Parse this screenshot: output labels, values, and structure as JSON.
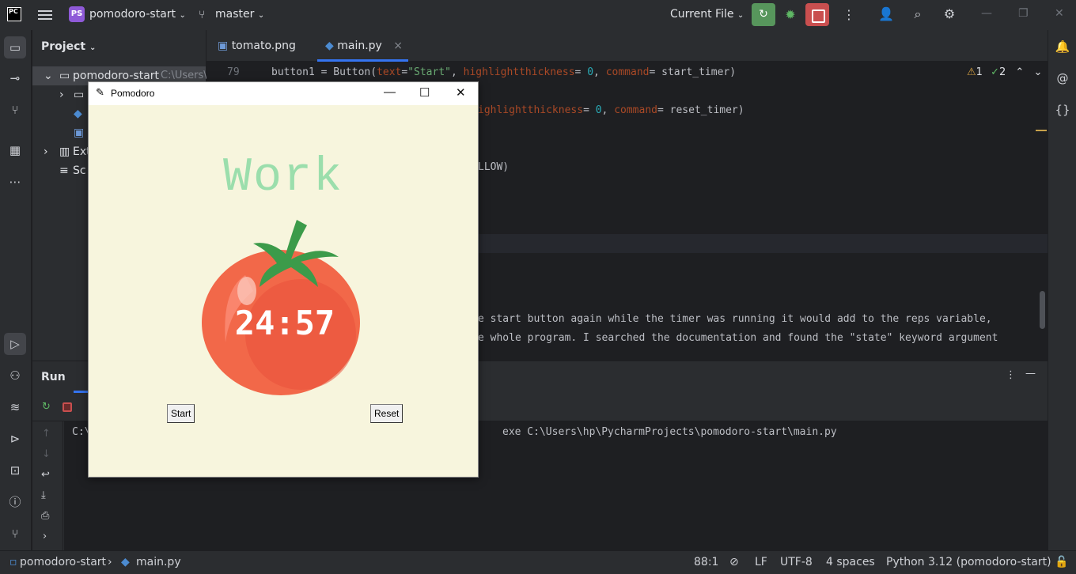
{
  "titlebar": {
    "logo_text": "PC",
    "project_badge": "PS",
    "project_name": "pomodoro-start",
    "branch": "master",
    "run_config": "Current File"
  },
  "project_pane": {
    "title": "Project",
    "root_name": "pomodoro-start",
    "root_path_hint": "C:\\Users\\",
    "ext_libs_partial": "Ext",
    "scratches_partial": "Sc"
  },
  "editor": {
    "tabs": [
      {
        "label": "tomato.png",
        "icon": "image-file-icon"
      },
      {
        "label": "main.py",
        "icon": "python-file-icon",
        "active": true
      }
    ],
    "line_number": "79",
    "inspections": {
      "warnings": "1",
      "typos": "2"
    },
    "lines": {
      "l1_a": "button1 = Button(",
      "l1_b": "text",
      "l1_c": "=",
      "l1_d": "\"Start\"",
      "l1_e": ", ",
      "l1_f": "highlightthickness",
      "l1_g": "= ",
      "l1_h": "0",
      "l1_i": ", ",
      "l1_j": "command",
      "l1_k": "= start_timer)",
      "l2_a": "ighlightthickness",
      "l2_b": "= ",
      "l2_c": "0",
      "l2_d": ", ",
      "l2_e": "command",
      "l2_f": "= reset_timer)",
      "l3": "LLOW)",
      "l4": "e start button again while the timer was running it would add to the reps variable,",
      "l5": "e whole program. I searched the documentation and found the \"state\" keyword argument"
    }
  },
  "run_panel": {
    "title": "Run",
    "console_prefix": "C:\\",
    "console_line": "exe C:\\Users\\hp\\PycharmProjects\\pomodoro-start\\main.py"
  },
  "statusbar": {
    "breadcrumb_project": "pomodoro-start",
    "breadcrumb_file": "main.py",
    "position": "88:1",
    "line_sep": "LF",
    "encoding": "UTF-8",
    "indent": "4 spaces",
    "interpreter": "Python 3.12 (pomodoro-start)"
  },
  "pomodoro_window": {
    "title": "Pomodoro",
    "heading": "Work",
    "timer": "24:57",
    "start_label": "Start",
    "reset_label": "Reset",
    "colors": {
      "background": "#f7f5dd",
      "heading": "#9bdeac",
      "tomato": "#f26849",
      "leaf": "#3c9b4a"
    }
  }
}
